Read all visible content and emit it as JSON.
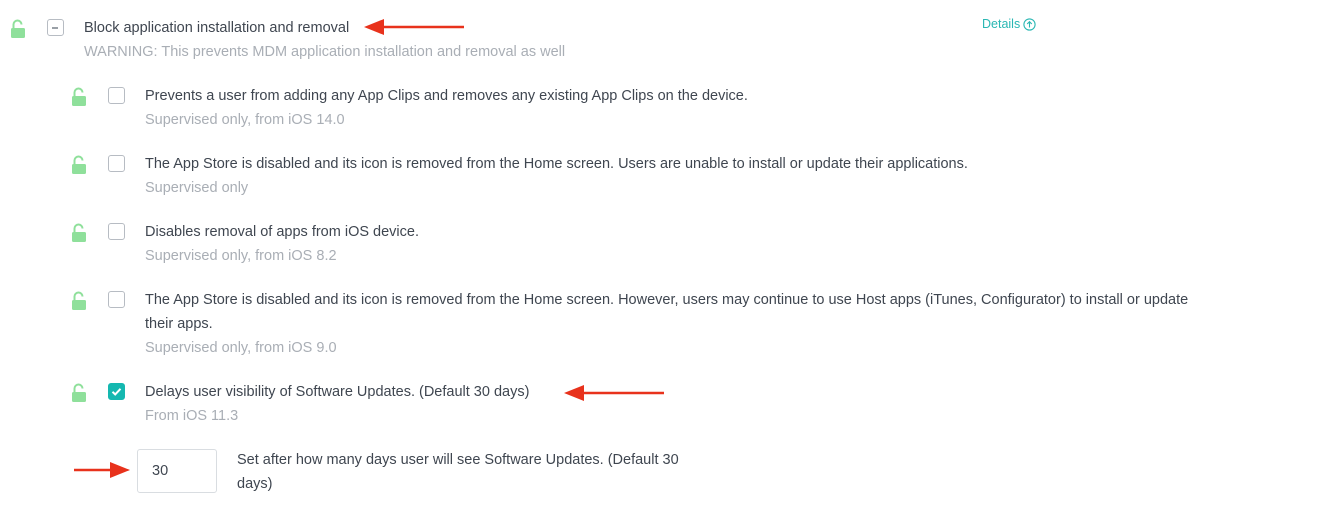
{
  "colors": {
    "unlock_icon": "#8fe09b",
    "accent": "#15b8b0",
    "annotation_arrow": "#e8321c",
    "subtext": "#a9aeb5"
  },
  "group": {
    "title": "Block application installation and removal",
    "warning": "WARNING: This prevents MDM application installation and removal as well",
    "details_label": "Details",
    "details_icon": "arrow-up-circle-icon",
    "checkbox_state": "indeterminate"
  },
  "options": [
    {
      "label": "Prevents a user from adding any App Clips and removes any existing App Clips on the device.",
      "note": "Supervised only, from iOS 14.0",
      "checked": false
    },
    {
      "label": "The App Store is disabled and its icon is removed from the Home screen. Users are unable to install or update their applications.",
      "note": "Supervised only",
      "checked": false
    },
    {
      "label": "Disables removal of apps from iOS device.",
      "note": "Supervised only, from iOS 8.2",
      "checked": false
    },
    {
      "label_line1": "The App Store is disabled and its icon is removed from the Home screen. However, users may continue to use Host apps (iTunes, Configurator) to install or update",
      "label_line2": "their apps.",
      "note": "Supervised only, from iOS 9.0",
      "checked": false
    },
    {
      "label": "Delays user visibility of Software Updates. (Default 30 days)",
      "note": "From iOS 11.3",
      "checked": true
    }
  ],
  "deferral": {
    "value": "30",
    "description_line1": "Set after how many days user will see Software Updates. (Default 30",
    "description_line2": "days)"
  }
}
